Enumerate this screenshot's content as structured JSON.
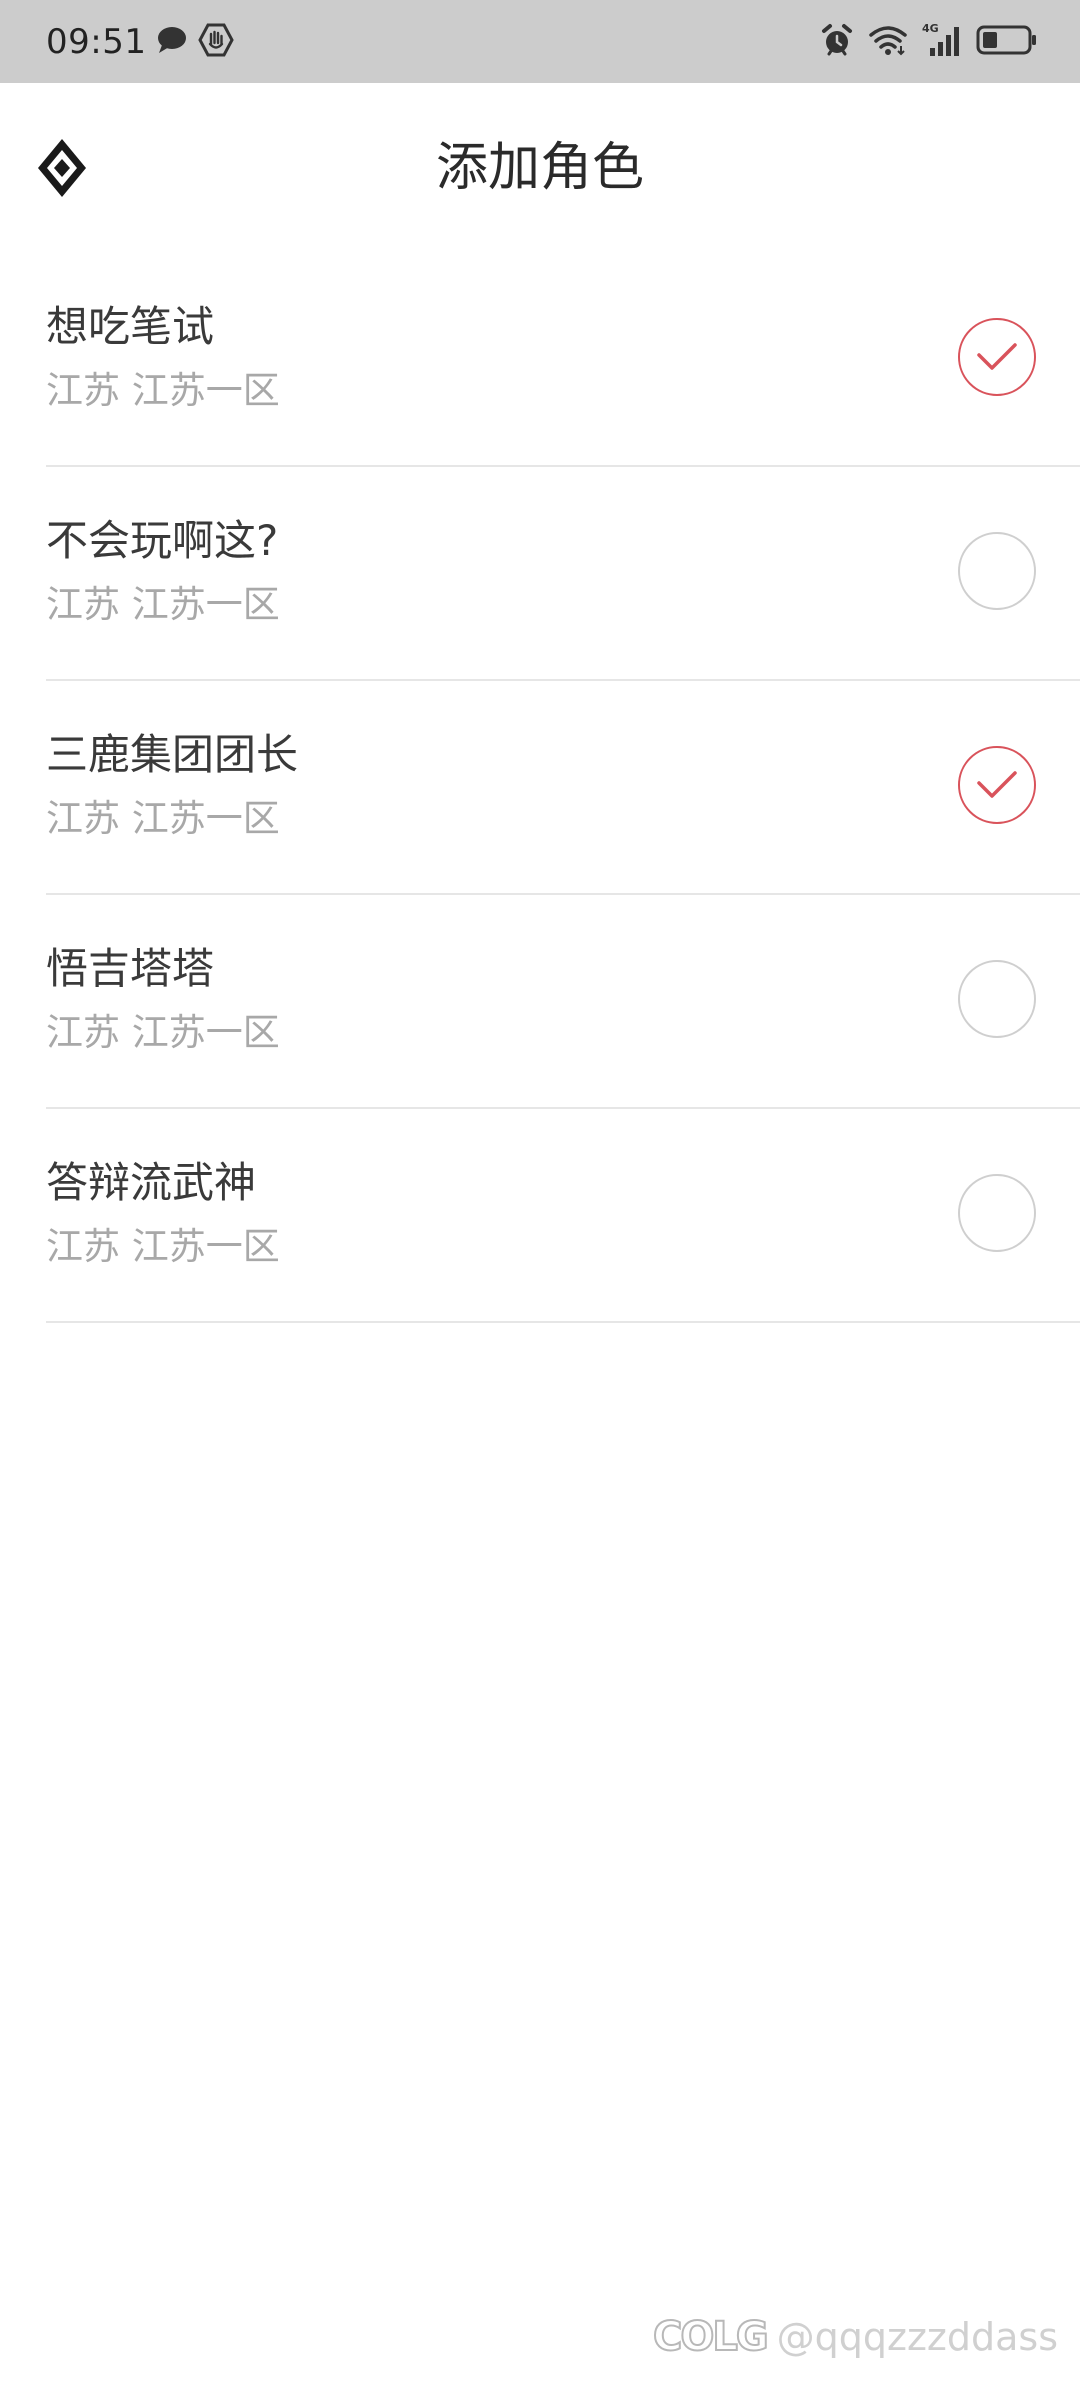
{
  "status_bar": {
    "time": "09:51",
    "left_icons": [
      "chat-bubble-icon",
      "hand-shield-icon"
    ],
    "right_icons": [
      "alarm-icon",
      "wifi-icon",
      "signal-4g-icon",
      "battery-icon"
    ],
    "network_label": "4G"
  },
  "header": {
    "title": "添加角色",
    "back_icon": "diamond-back-icon"
  },
  "roles": [
    {
      "name": "想吃笔试",
      "server": "江苏 江苏一区",
      "checked": true
    },
    {
      "name": "不会玩啊这?",
      "server": "江苏 江苏一区",
      "checked": false
    },
    {
      "name": "三鹿集团团长",
      "server": "江苏 江苏一区",
      "checked": true
    },
    {
      "name": "悟吉塔塔",
      "server": "江苏 江苏一区",
      "checked": false
    },
    {
      "name": "答辩流武神",
      "server": "江苏 江苏一区",
      "checked": false
    }
  ],
  "colors": {
    "accent": "#d9535b",
    "status_bar_bg": "#cccccc",
    "divider": "#e6e6e6",
    "secondary_text": "#a8a8a8"
  },
  "watermark": {
    "logo": "COLG",
    "handle": "@qqqzzzddass"
  }
}
